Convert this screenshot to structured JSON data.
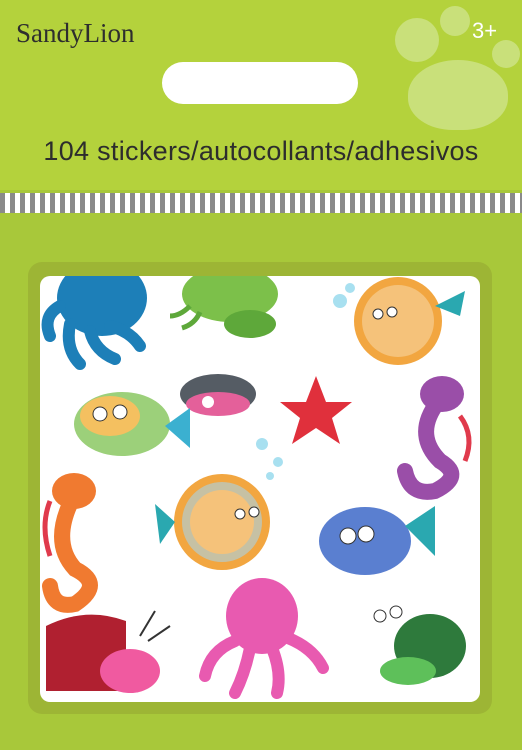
{
  "brand": {
    "logo_text": "SandyLion",
    "age_rating": "3+"
  },
  "package": {
    "sticker_count_label": "104 stickers/autocollants/adhesivos"
  },
  "colors": {
    "background_green": "#a8c83a",
    "stripe_grey": "#8a8a8a"
  },
  "stickers": [
    "octopus-sticker",
    "crab-sticker",
    "pufferfish-sticker",
    "clam-sticker",
    "starfish-sticker",
    "seahorse-sticker",
    "fish-sticker",
    "seahorse-sticker",
    "pufferfish-sticker",
    "fish-sticker",
    "hermit-crab-sticker",
    "octopus-sticker",
    "hermit-crab-sticker"
  ]
}
